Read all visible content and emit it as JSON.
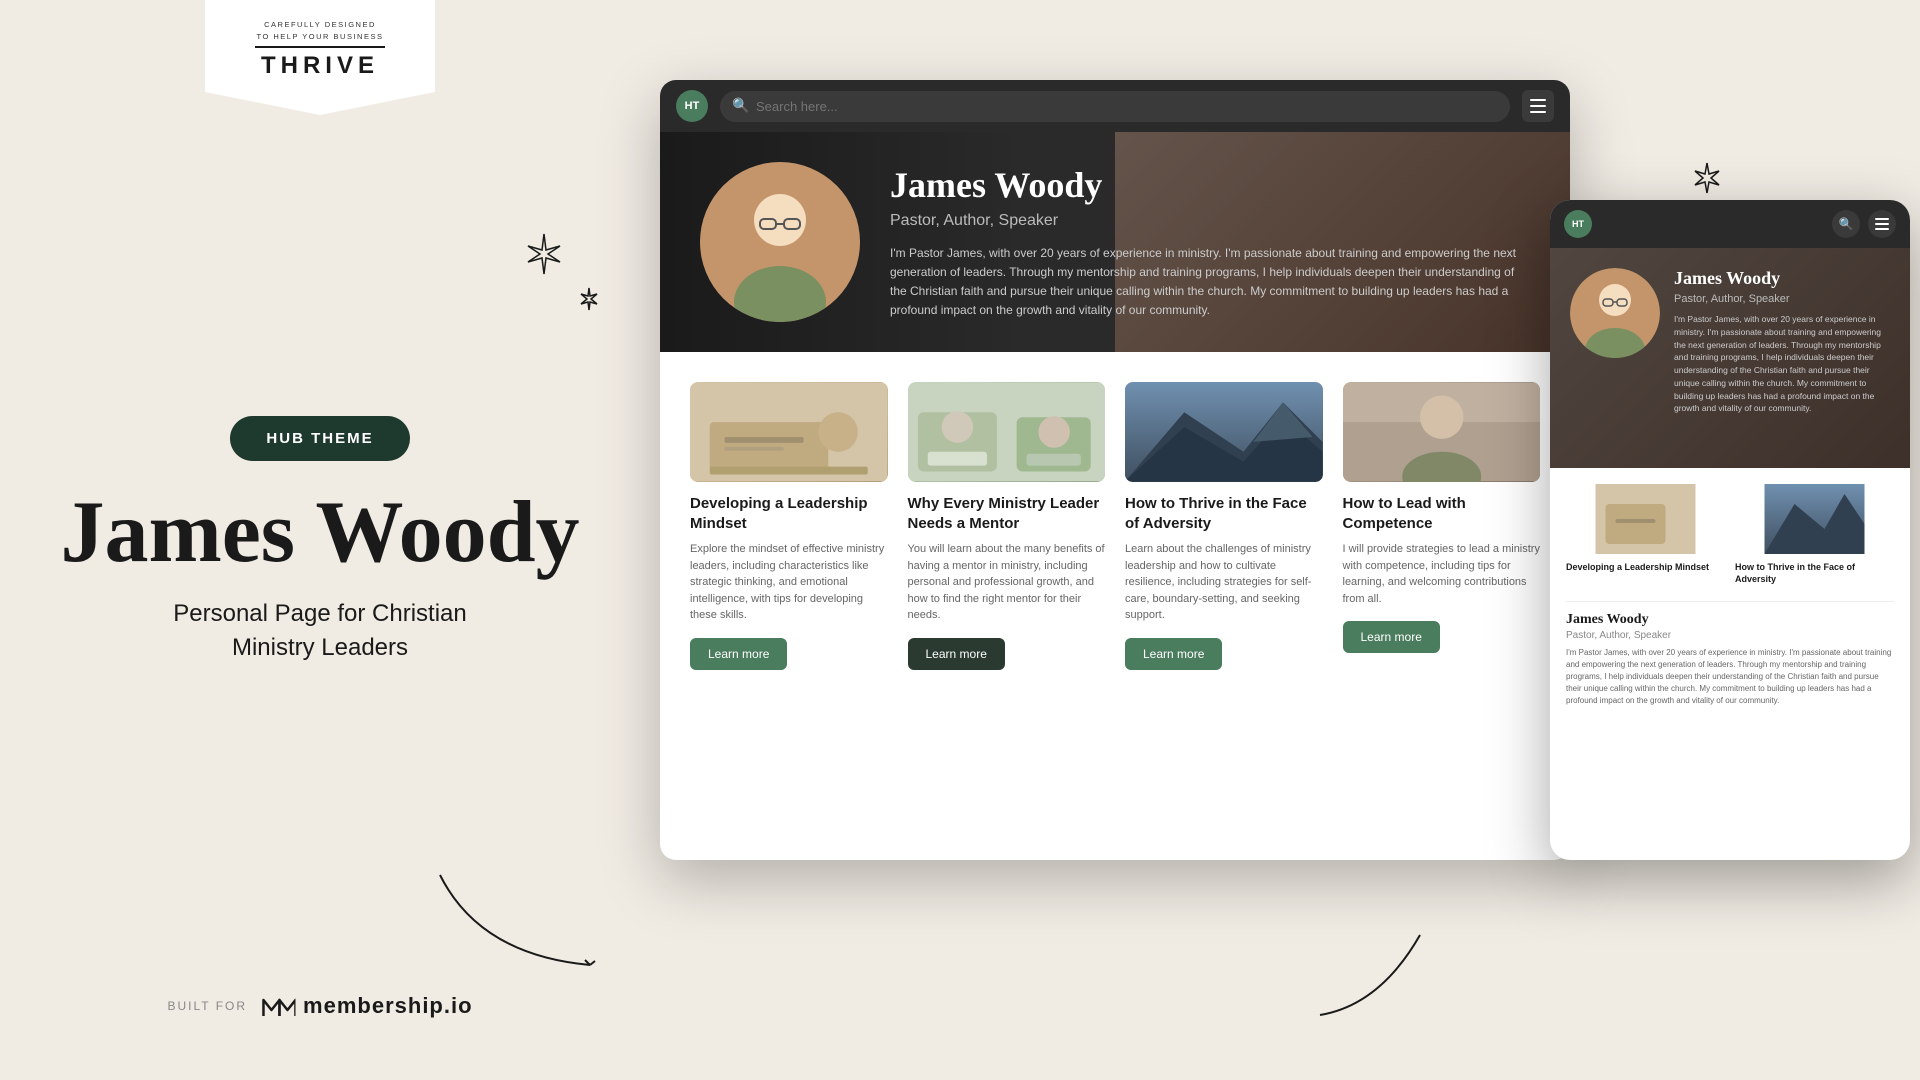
{
  "page": {
    "background": "#f0ebe3"
  },
  "logo": {
    "carefully": "CAREFULLY DESIGNED",
    "to_help": "TO HELP YOUR BUSINESS",
    "thrive": "THRIVE"
  },
  "badge": {
    "label": "HUB THEME"
  },
  "hero_left": {
    "name": "James Woody",
    "subtitle": "Personal Page for Christian\nMinistry Leaders"
  },
  "built_for": {
    "prefix": "BUILT FOR",
    "brand": "membership.io"
  },
  "browser": {
    "avatar_initials": "HT",
    "search_placeholder": "Search here...",
    "hero": {
      "name": "James Woody",
      "title": "Pastor, Author, Speaker",
      "bio": "I'm Pastor James, with over 20 years of experience in ministry. I'm passionate about training and empowering the next generation of leaders. Through my mentorship and training programs, I help individuals deepen their understanding of the Christian faith and pursue their unique calling within the church. My commitment to building up leaders has had a profound impact on the growth and vitality of our community."
    },
    "cards": [
      {
        "id": "card1",
        "title": "Developing a Leadership Mindset",
        "description": "Explore the mindset of effective ministry leaders, including characteristics like strategic thinking, and emotional intelligence, with tips for developing these skills.",
        "cta": "Learn more",
        "img_type": "desk"
      },
      {
        "id": "card2",
        "title": "Why Every Ministry Leader Needs a Mentor",
        "description": "You will learn about the many benefits of having a mentor in ministry, including personal and professional growth, and how to find the right mentor for their needs.",
        "cta": "Learn more",
        "img_type": "meeting"
      },
      {
        "id": "card3",
        "title": "How to Thrive in the Face of Adversity",
        "description": "Learn about the challenges of ministry leadership and how to cultivate resilience, including strategies for self-care, boundary-setting, and seeking support.",
        "cta": "Learn more",
        "img_type": "mountain"
      },
      {
        "id": "card4",
        "title": "How to Lead with Competence",
        "description": "I will provide strategies to lead a ministry with competence, including tips for learning, and welcoming contributions from all.",
        "cta": "Learn more",
        "img_type": "person"
      }
    ]
  },
  "mobile": {
    "avatar_initials": "HT",
    "hero": {
      "name": "James Woody",
      "title": "Pastor, Author, Speaker",
      "bio": "I'm Pastor James, with over 20 years of experience in ministry. I'm passionate about training and empowering the next generation of leaders. Through my mentorship and training programs, I help individuals deepen their understanding of the Christian faith and pursue their unique calling within the church. My commitment to building up leaders has had a profound impact on the growth and vitality of our community."
    }
  }
}
